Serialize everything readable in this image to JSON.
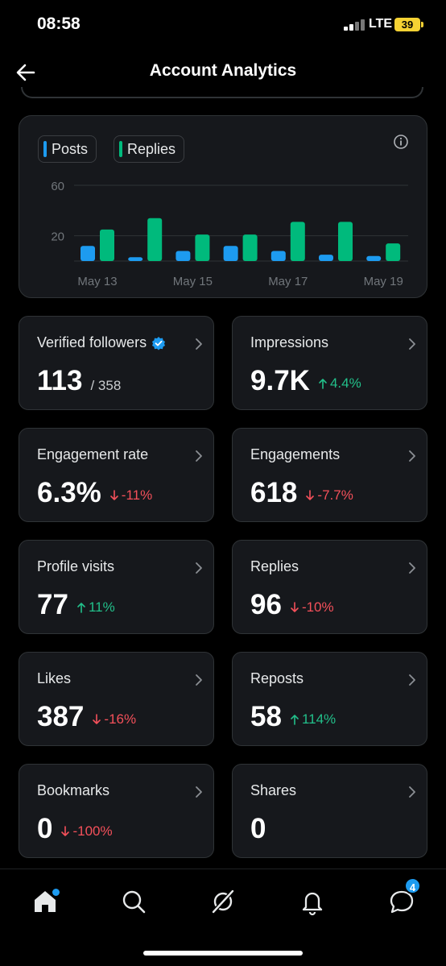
{
  "status_bar": {
    "time": "08:58",
    "network": "LTE",
    "battery": "39"
  },
  "header": {
    "title": "Account Analytics"
  },
  "chart_data": {
    "type": "bar",
    "categories": [
      "May 13",
      "May 14",
      "May 15",
      "May 16",
      "May 17",
      "May 18",
      "May 19"
    ],
    "x_tick_labels": [
      "May 13",
      "May 15",
      "May 17",
      "May 19"
    ],
    "series": [
      {
        "name": "Posts",
        "color": "#1d9bf0",
        "values": [
          12,
          3,
          8,
          12,
          8,
          5,
          4
        ]
      },
      {
        "name": "Replies",
        "color": "#00ba7c",
        "values": [
          25,
          34,
          21,
          21,
          31,
          31,
          14
        ]
      }
    ],
    "y_ticks": [
      20,
      60
    ],
    "ylim": [
      0,
      60
    ],
    "grid": true
  },
  "stats": [
    {
      "label": "Verified followers",
      "value": "113",
      "sub": "/ 358",
      "verified": true
    },
    {
      "label": "Impressions",
      "value": "9.7K",
      "delta": "4.4%",
      "direction": "up"
    },
    {
      "label": "Engagement rate",
      "value": "6.3%",
      "delta": "-11%",
      "direction": "down"
    },
    {
      "label": "Engagements",
      "value": "618",
      "delta": "-7.7%",
      "direction": "down"
    },
    {
      "label": "Profile visits",
      "value": "77",
      "delta": "11%",
      "direction": "up"
    },
    {
      "label": "Replies",
      "value": "96",
      "delta": "-10%",
      "direction": "down"
    },
    {
      "label": "Likes",
      "value": "387",
      "delta": "-16%",
      "direction": "down"
    },
    {
      "label": "Reposts",
      "value": "58",
      "delta": "114%",
      "direction": "up"
    },
    {
      "label": "Bookmarks",
      "value": "0",
      "delta": "-100%",
      "direction": "down"
    },
    {
      "label": "Shares",
      "value": "0"
    }
  ],
  "bottom_nav": {
    "items": [
      "home-icon",
      "search-icon",
      "grok-icon",
      "notifications-icon",
      "messages-icon"
    ],
    "messages_badge": "4"
  },
  "colors": {
    "posts": "#1d9bf0",
    "replies": "#00ba7c",
    "up": "#22c08a",
    "down": "#f4505a",
    "card": "#16181c"
  }
}
